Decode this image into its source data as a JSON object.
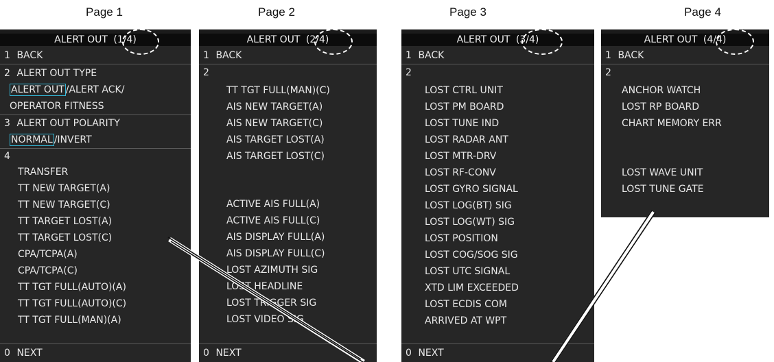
{
  "captions": [
    "Page 1",
    "Page 2",
    "Page 3",
    "Page 4"
  ],
  "panel1": {
    "title": "ALERT OUT",
    "page_indicator": "(1/4)",
    "back": {
      "num": "1",
      "label": "BACK"
    },
    "type": {
      "num": "2",
      "label": "ALERT OUT TYPE"
    },
    "type_option_selected": "ALERT OUT",
    "type_option_rest": "/ALERT ACK/",
    "type_option_line2": "OPERATOR FITNESS",
    "polarity": {
      "num": "3",
      "label": "ALERT OUT POLARITY"
    },
    "polarity_option_selected": "NORMAL",
    "polarity_option_rest": "/INVERT",
    "group_num": "4",
    "items": [
      "TRANSFER",
      "TT NEW TARGET(A)",
      "TT NEW TARGET(C)",
      "TT TARGET LOST(A)",
      "TT TARGET LOST(C)",
      "CPA/TCPA(A)",
      "CPA/TCPA(C)",
      "TT TGT FULL(AUTO)(A)",
      "TT TGT FULL(AUTO)(C)",
      "TT TGT FULL(MAN)(A)"
    ],
    "next": {
      "num": "0",
      "label": "NEXT"
    }
  },
  "panel2": {
    "title": "ALERT OUT",
    "page_indicator": "(2/4)",
    "back": {
      "num": "1",
      "label": "BACK"
    },
    "group_num": "2",
    "items_a": [
      "TT TGT FULL(MAN)(C)",
      "AIS NEW TARGET(A)",
      "AIS NEW TARGET(C)",
      "AIS TARGET LOST(A)",
      "AIS TARGET LOST(C)"
    ],
    "items_b": [
      "ACTIVE AIS FULL(A)",
      "ACTIVE AIS FULL(C)",
      "AIS DISPLAY FULL(A)",
      "AIS DISPLAY FULL(C)",
      "LOST AZIMUTH SIG",
      "LOST HEADLINE",
      "LOST TRIGGER SIG",
      "LOST VIDEO SIG"
    ],
    "next": {
      "num": "0",
      "label": "NEXT"
    }
  },
  "panel3": {
    "title": "ALERT OUT",
    "page_indicator": "(3/4)",
    "back": {
      "num": "1",
      "label": "BACK"
    },
    "group_num": "2",
    "items": [
      "LOST CTRL UNIT",
      "LOST PM BOARD",
      "LOST TUNE IND",
      "LOST RADAR ANT",
      "LOST MTR-DRV",
      "LOST RF-CONV",
      "LOST GYRO SIGNAL",
      "LOST LOG(BT) SIG",
      "LOST LOG(WT) SIG",
      "LOST POSITION",
      "LOST COG/SOG SIG",
      "LOST UTC SIGNAL",
      "XTD LIM EXCEEDED",
      "LOST ECDIS COM",
      "ARRIVED AT WPT"
    ],
    "next": {
      "num": "0",
      "label": "NEXT"
    }
  },
  "panel4": {
    "title": "ALERT OUT",
    "page_indicator": "(4/4)",
    "back": {
      "num": "1",
      "label": "BACK"
    },
    "group_num": "2",
    "items_a": [
      "ANCHOR WATCH",
      "LOST RP BOARD",
      "CHART MEMORY ERR"
    ],
    "items_b": [
      "LOST WAVE UNIT",
      "LOST TUNE GATE"
    ]
  },
  "colors": {
    "panel_bg": "#262626",
    "text": "#e8e8e8",
    "selection_border": "#33b6d6",
    "title_bg": "#0c0c0c"
  }
}
